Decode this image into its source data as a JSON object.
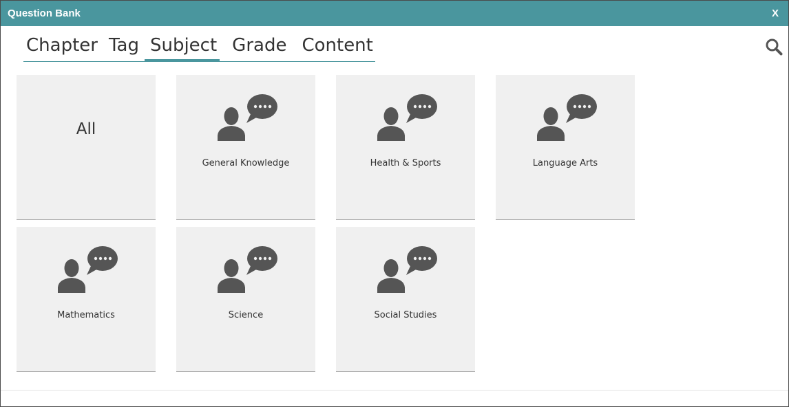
{
  "dialog": {
    "title": "Question Bank",
    "close_label": "X"
  },
  "tabs": [
    {
      "label": "Chapter",
      "active": false
    },
    {
      "label": "Tag",
      "active": false
    },
    {
      "label": "Subject",
      "active": true
    },
    {
      "label": "Grade",
      "active": false
    },
    {
      "label": "Content",
      "active": false
    }
  ],
  "search": {
    "icon": "search-icon"
  },
  "cards": [
    {
      "label": "All",
      "icon": null
    },
    {
      "label": "General Knowledge",
      "icon": "person-speech-icon"
    },
    {
      "label": "Health & Sports",
      "icon": "person-speech-icon"
    },
    {
      "label": "Language Arts",
      "icon": "person-speech-icon"
    },
    {
      "label": "Mathematics",
      "icon": "person-speech-icon"
    },
    {
      "label": "Science",
      "icon": "person-speech-icon"
    },
    {
      "label": "Social Studies",
      "icon": "person-speech-icon"
    }
  ],
  "colors": {
    "accent": "#4a969e",
    "card_bg": "#f0f0f0",
    "icon": "#555555",
    "text": "#333333"
  }
}
